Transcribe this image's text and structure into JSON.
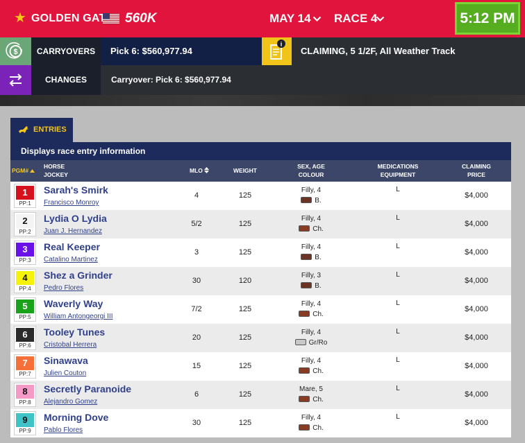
{
  "header": {
    "track": "GOLDEN GATE",
    "pool": "560K",
    "date": "MAY 14",
    "race": "RACE 4",
    "time": "5:12 PM"
  },
  "carryovers": {
    "label": "CARRYOVERS",
    "value": "Pick 6: $560,977.94"
  },
  "race_info": {
    "value": "CLAIMING, 5 1/2F, All Weather Track"
  },
  "changes": {
    "label": "CHANGES",
    "value": "Carryover: Pick 6: $560,977.94"
  },
  "tab": {
    "label": "ENTRIES"
  },
  "description": "Displays race entry information",
  "columns": {
    "pgm": "PGM#",
    "horse": "HORSE",
    "jockey": "JOCKEY",
    "mlo": "MLO",
    "weight": "WEIGHT",
    "sex_age": "SEX, AGE",
    "colour": "COLOUR",
    "medications": "MEDICATIONS",
    "equipment": "EQUIPMENT",
    "claiming": "CLAIMING",
    "price": "PRICE"
  },
  "entries": [
    {
      "pgm": "1",
      "pp": "PP:1",
      "horse": "Sarah's Smirk",
      "jockey": "Francisco Monroy",
      "mlo": "4",
      "weight": "125",
      "sex_age": "Filly, 4",
      "colour": "B.",
      "med": "L",
      "price": "$4,000",
      "pgm_bg": "#d4111d",
      "pgm_fg": "#ffffff",
      "swatch": "#6b3324"
    },
    {
      "pgm": "2",
      "pp": "PP:2",
      "horse": "Lydia O Lydia",
      "jockey": "Juan J. Hernandez",
      "mlo": "5/2",
      "weight": "125",
      "sex_age": "Filly, 4",
      "colour": "Ch.",
      "med": "L",
      "price": "$4,000",
      "pgm_bg": "#f4f4f4",
      "pgm_fg": "#111111",
      "swatch": "#8a3b24"
    },
    {
      "pgm": "3",
      "pp": "PP:3",
      "horse": "Real Keeper",
      "jockey": "Catalino Martinez",
      "mlo": "3",
      "weight": "125",
      "sex_age": "Filly, 4",
      "colour": "B.",
      "med": "L",
      "price": "$4,000",
      "pgm_bg": "#6a10e8",
      "pgm_fg": "#ffffff",
      "swatch": "#6b3324"
    },
    {
      "pgm": "4",
      "pp": "PP:4",
      "horse": "Shez a Grinder",
      "jockey": "Pedro Flores",
      "mlo": "30",
      "weight": "120",
      "sex_age": "Filly, 3",
      "colour": "B.",
      "med": "L",
      "price": "$4,000",
      "pgm_bg": "#f6f20a",
      "pgm_fg": "#111111",
      "swatch": "#6b3324"
    },
    {
      "pgm": "5",
      "pp": "PP:5",
      "horse": "Waverly Way",
      "jockey": "William Antongeorgi III",
      "mlo": "7/2",
      "weight": "125",
      "sex_age": "Filly, 4",
      "colour": "Ch.",
      "med": "L",
      "price": "$4,000",
      "pgm_bg": "#1aa31a",
      "pgm_fg": "#ffffff",
      "swatch": "#8a3b24"
    },
    {
      "pgm": "6",
      "pp": "PP:6",
      "horse": "Tooley Tunes",
      "jockey": "Cristobal Herrera",
      "mlo": "20",
      "weight": "125",
      "sex_age": "Filly, 4",
      "colour": "Gr/Ro",
      "med": "L",
      "price": "$4,000",
      "pgm_bg": "#2b2b2b",
      "pgm_fg": "#ffffff",
      "swatch": "#c8c8c8"
    },
    {
      "pgm": "7",
      "pp": "PP:7",
      "horse": "Sinawava",
      "jockey": "Julien Couton",
      "mlo": "15",
      "weight": "125",
      "sex_age": "Filly, 4",
      "colour": "Ch.",
      "med": "L",
      "price": "$4,000",
      "pgm_bg": "#f7703a",
      "pgm_fg": "#ffffff",
      "swatch": "#8a3b24"
    },
    {
      "pgm": "8",
      "pp": "PP:8",
      "horse": "Secretly Paranoide",
      "jockey": "Alejandro Gomez",
      "mlo": "6",
      "weight": "125",
      "sex_age": "Mare, 5",
      "colour": "Ch.",
      "med": "L",
      "price": "$4,000",
      "pgm_bg": "#f59ac6",
      "pgm_fg": "#111111",
      "swatch": "#8a3b24"
    },
    {
      "pgm": "9",
      "pp": "PP:9",
      "horse": "Morning Dove",
      "jockey": "Pablo Flores",
      "mlo": "30",
      "weight": "125",
      "sex_age": "Filly, 4",
      "colour": "Ch.",
      "med": "L",
      "price": "$4,000",
      "pgm_bg": "#3fc3c6",
      "pgm_fg": "#111111",
      "swatch": "#8a3b24"
    }
  ]
}
